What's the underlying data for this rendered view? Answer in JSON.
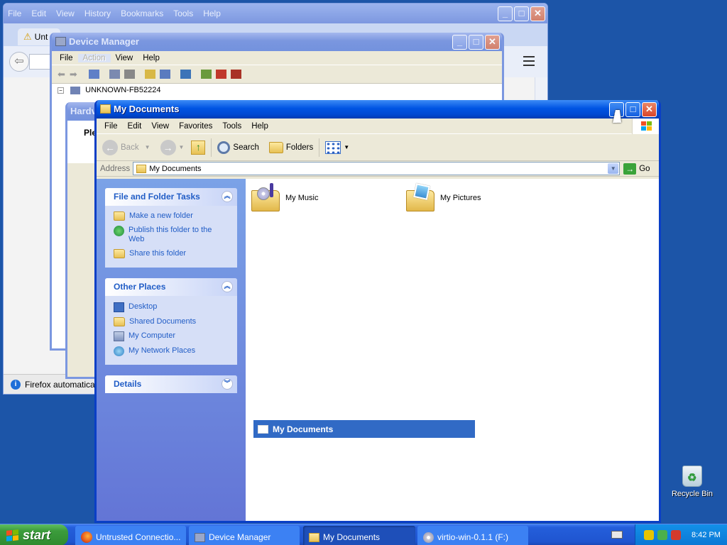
{
  "firefox": {
    "menu": [
      "File",
      "Edit",
      "View",
      "History",
      "Bookmarks",
      "Tools",
      "Help"
    ],
    "tab_label": "Unt",
    "notification": "Firefox automaticall"
  },
  "device_manager": {
    "title": "Device Manager",
    "menu": [
      "File",
      "Action",
      "View",
      "Help"
    ],
    "tree_root": "UNKNOWN-FB52224"
  },
  "hardware_dialog": {
    "title": "Hardv",
    "text": "Ple"
  },
  "my_documents": {
    "title": "My Documents",
    "menu": [
      "File",
      "Edit",
      "View",
      "Favorites",
      "Tools",
      "Help"
    ],
    "toolbar": {
      "back": "Back",
      "search": "Search",
      "folders": "Folders"
    },
    "address": {
      "label": "Address",
      "value": "My Documents",
      "go": "Go"
    },
    "file_tasks": {
      "header": "File and Folder Tasks",
      "items": [
        "Make a new folder",
        "Publish this folder to the Web",
        "Share this folder"
      ]
    },
    "other_places": {
      "header": "Other Places",
      "items": [
        "Desktop",
        "Shared Documents",
        "My Computer",
        "My Network Places"
      ]
    },
    "details": {
      "header": "Details"
    },
    "files": [
      {
        "name": "My Music",
        "icon": "music-folder-icon"
      },
      {
        "name": "My Pictures",
        "icon": "pictures-folder-icon"
      }
    ],
    "selection_label": "My Documents"
  },
  "desktop": {
    "recycle_bin": "Recycle Bin"
  },
  "taskbar": {
    "start": "start",
    "tasks": [
      "Untrusted Connectio...",
      "Device Manager",
      "My Documents",
      "virtio-win-0.1.1 (F:)"
    ],
    "clock": "8:42 PM"
  },
  "colors": {
    "desktop": "#1c55a8",
    "taskbar": "#245edb",
    "start": "#3c9c3c",
    "link": "#215dc6",
    "selection": "#316ac5"
  }
}
